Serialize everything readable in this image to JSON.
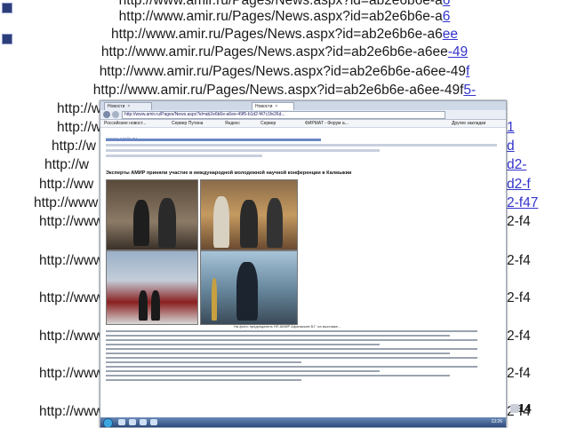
{
  "url_lines": [
    {
      "main": "http://www.amir.ru/Pages/News.aspx?id=ab2e6b6e-a",
      "tail": "6"
    },
    {
      "main": "http://www.amir.ru/Pages/News.aspx?id=ab2e6b6e-a6",
      "tail": "ee"
    },
    {
      "main": "http://www.amir.ru/Pages/News.aspx?id=ab2e6b6e-a6ee",
      "tail": "-49"
    },
    {
      "main": "http://www.amir.ru/Pages/News.aspx?id=ab2e6b6e-a6ee-49",
      "tail": "f"
    },
    {
      "main": "http://www.amir.ru/Pages/News.aspx?id=ab2e6b6e-a6ee-49f",
      "tail": "5-"
    }
  ],
  "left_fragments": [
    "http://w",
    "http://w",
    "http://w",
    "http://w",
    "http://ww",
    "http://www",
    "http://www",
    "http://www",
    "http://www",
    "http://www",
    "http://www",
    "http://www"
  ],
  "right_fragments": [
    {
      "text": "1",
      "link": true
    },
    {
      "text": "d",
      "link": true
    },
    {
      "text": "d2-",
      "link": true
    },
    {
      "text": "d2-f",
      "link": true
    },
    {
      "text": "2-f47",
      "link": true
    },
    {
      "text": "2-f4",
      "link": false
    },
    {
      "text": "2-f4",
      "link": false
    },
    {
      "text": "2-f4",
      "link": false
    },
    {
      "text": "2-f4",
      "link": false
    },
    {
      "text": "2-f4",
      "link": false
    },
    {
      "text": "2-f4",
      "link": false
    }
  ],
  "slide_number": "14",
  "browser": {
    "tabs": [
      "Новости",
      "Новости"
    ],
    "tab_close": "×",
    "address": "http://www.amir.ru/Pages/News.aspx?id=ab2e6b6e-a6ee-49f5-b1d2-f47c1fe26d...",
    "bookmarks": [
      "Российские новост...",
      "Сервер Путина",
      "Яндекс",
      "Сервер",
      "ФИРМАТ - Форум а...",
      "Другие закладки"
    ],
    "site_logo": "www.amir.ru",
    "article_title": "Эксперты АМИР приняли участие в международной молодежной научной конференции в Калмыкии",
    "caption1": "На фото: заместитель ОГАП АМИР поздравляет...",
    "caption2": "На фото: председатель НП АМИР Афанасьев В.Г. на выставке...",
    "tray_time": "13:26"
  },
  "colors": {
    "link": "#3333cc",
    "text": "#1a1a1a",
    "bullet": "#2c3e7a"
  }
}
